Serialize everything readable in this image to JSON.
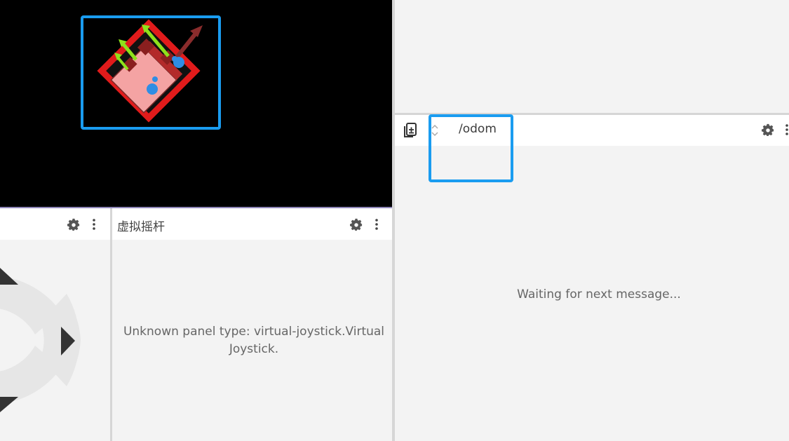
{
  "viewport": {
    "background": "#000000"
  },
  "joystick_panel": {
    "title": "虚拟摇杆",
    "message": "Unknown panel type: virtual-joystick.Virtual Joystick."
  },
  "raw_message_panel": {
    "topic": "/odom",
    "status": "Waiting for next message..."
  },
  "icons": {
    "settings": "gear-icon",
    "more": "vertical-ellipsis-icon",
    "copy": "clipboard-icon",
    "sort": "up-down-chevron-icon"
  },
  "colors": {
    "highlight": "#1a9cf0",
    "divider": "#d6d6d6"
  }
}
